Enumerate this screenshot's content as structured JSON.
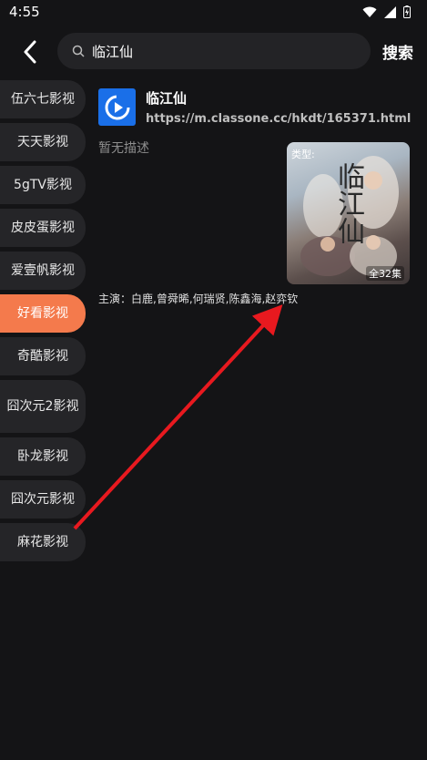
{
  "status_bar": {
    "time": "4:55"
  },
  "header": {
    "search_value": "临江仙",
    "search_button": "搜索"
  },
  "sidebar": {
    "items": [
      {
        "label": "伍六七影视",
        "active": false
      },
      {
        "label": "天天影视",
        "active": false
      },
      {
        "label": "5gTV影视",
        "active": false
      },
      {
        "label": "皮皮蛋影视",
        "active": false
      },
      {
        "label": "爱壹帆影视",
        "active": false
      },
      {
        "label": "好看影视",
        "active": true
      },
      {
        "label": "奇酷影视",
        "active": false
      },
      {
        "label": "囧次元2影视",
        "active": false
      },
      {
        "label": "卧龙影视",
        "active": false
      },
      {
        "label": "囧次元影视",
        "active": false
      },
      {
        "label": "麻花影视",
        "active": false
      }
    ]
  },
  "result": {
    "title": "临江仙",
    "url": "https://m.classone.cc/hkdt/165371.html",
    "description": "暂无描述",
    "poster_type": "类型:",
    "poster_title": "临江仙",
    "episodes": "全32集",
    "cast": "主演：白鹿,曾舜晞,何瑞贤,陈鑫海,赵弈钦"
  },
  "colors": {
    "accent": "#f47a4c",
    "background": "#141416",
    "arrow": "#e8191f"
  }
}
